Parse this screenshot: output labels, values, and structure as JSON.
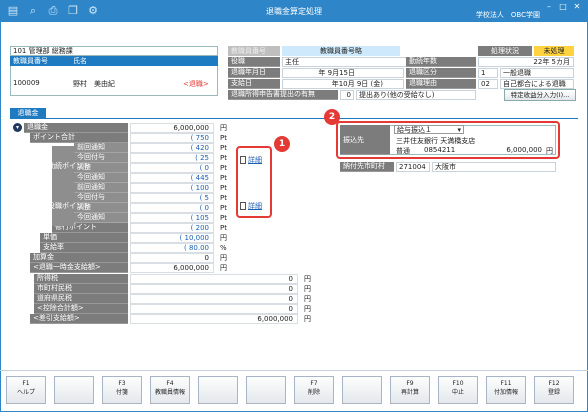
{
  "window": {
    "title": "退職金算定処理",
    "company": "学校法人　OBC学園"
  },
  "header": {
    "dept": "101 管理部 総務課",
    "col_no": "教職員番号",
    "col_name": "氏名",
    "emp_no": "100009",
    "emp_name": "野村　美由紀",
    "retired_badge": "<退職>",
    "mid_label": "教職員番号略",
    "status_label": "処理状況",
    "status_value": "未処理",
    "rows": [
      {
        "l": "役職",
        "v": "主任",
        "l2": "勤続年数",
        "v2": "22年 5カ月"
      },
      {
        "l": "退職年月日",
        "v": "年 9月15日",
        "l2": "退職区分",
        "code": "1",
        "v2": "一般退職"
      },
      {
        "l": "支給日",
        "v": "年10月 9日 (金)",
        "l2": "退職理由",
        "code": "02",
        "v2": "自己都合による退職"
      }
    ],
    "declaration_label": "退職所得申告書提出の有無",
    "declaration_code": "0",
    "declaration_value": "提出あり(他の受給なし)",
    "special_button": "特定收益分入力(I)..."
  },
  "tab": "退職金",
  "calc": {
    "rows": [
      {
        "label": "退職金",
        "value": "6,000,000",
        "unit": "円"
      },
      {
        "label": "ポイント合計",
        "value": "( 750",
        "unit": "Pt"
      },
      {
        "label": "前回通知",
        "value": "( 420",
        "unit": "Pt"
      },
      {
        "label": "今回付与",
        "value": "( 25",
        "unit": "Pt"
      },
      {
        "label": "調整",
        "value": "( 0",
        "unit": "Pt"
      },
      {
        "label": "今回通知",
        "value": "( 445",
        "unit": "Pt"
      },
      {
        "label": "前回通知",
        "value": "( 100",
        "unit": "Pt"
      },
      {
        "label": "今回付与",
        "value": "( 5",
        "unit": "Pt"
      },
      {
        "label": "調整",
        "value": "( 0",
        "unit": "Pt"
      },
      {
        "label": "今回通知",
        "value": "( 105",
        "unit": "Pt"
      },
      {
        "label": "修行ポイント",
        "value": "( 200",
        "unit": "Pt"
      },
      {
        "label": "単価",
        "value": "( 10,000",
        "unit": "円"
      },
      {
        "label": "支給率",
        "value": "( 80.00",
        "unit": "%"
      },
      {
        "label": "加算金",
        "value": "0",
        "unit": "円"
      },
      {
        "label": "<退職一時金支給額>",
        "value": "6,000,000",
        "unit": "円"
      },
      {
        "label": "所得税",
        "value": "0",
        "unit": "円"
      },
      {
        "label": "市町村民税",
        "value": "0",
        "unit": "円"
      },
      {
        "label": "道府県民税",
        "value": "0",
        "unit": "円"
      },
      {
        "label": "<控除合計額>",
        "value": "0",
        "unit": "円"
      },
      {
        "label": "<差引支給額>",
        "value": "6,000,000",
        "unit": "円"
      }
    ],
    "group_kinzoku": "勤続ポイント",
    "group_yakushoku": "役職ポイント",
    "detail_link": "詳細"
  },
  "transfer": {
    "label": "振込先",
    "select": "給与振込１",
    "bank": "三井住友銀行 天満橋支店",
    "account_type": "普通",
    "account_no": "0854211",
    "amount": "6,000,000",
    "unit": "円",
    "city_label": "納付先市町村",
    "city_code": "271004",
    "city_name": "大阪市"
  },
  "callouts": [
    "1",
    "2"
  ],
  "fkeys": [
    {
      "k": "F1",
      "l": "ヘルプ"
    },
    {
      "k": "",
      "l": ""
    },
    {
      "k": "F3",
      "l": "付箋"
    },
    {
      "k": "F4",
      "l": "教職員情報"
    },
    {
      "k": "",
      "l": ""
    },
    {
      "k": "",
      "l": ""
    },
    {
      "k": "F7",
      "l": "削除"
    },
    {
      "k": "",
      "l": ""
    },
    {
      "k": "F9",
      "l": "再計算"
    },
    {
      "k": "F10",
      "l": "中止"
    },
    {
      "k": "F11",
      "l": "付加情報"
    },
    {
      "k": "F12",
      "l": "登録"
    }
  ]
}
